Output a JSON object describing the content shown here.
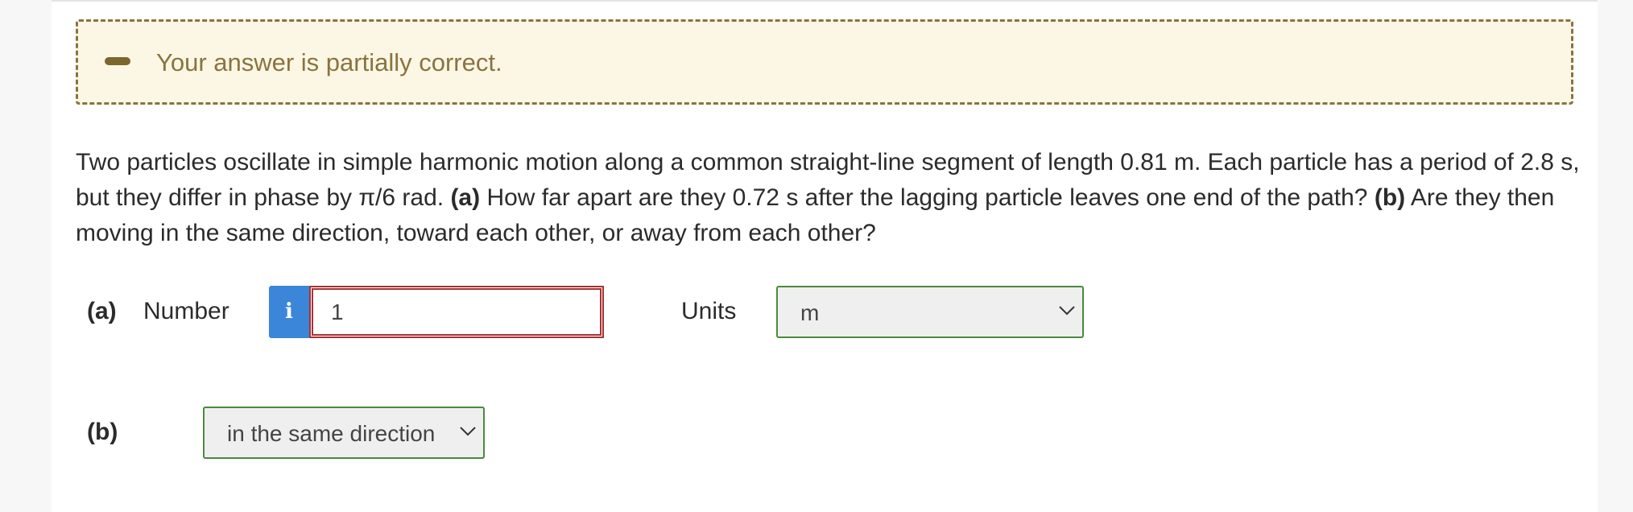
{
  "feedback": {
    "message": "Your answer is partially correct."
  },
  "question": {
    "intro": "Two particles oscillate in simple harmonic motion along a common straight-line segment of length 0.81 m. Each particle has a period of 2.8 s, but they differ in phase by π/6 rad.",
    "part_a_tag": "(a)",
    "part_a_text": "How far apart are they 0.72 s after the lagging particle leaves one end of the path?",
    "part_b_tag": "(b)",
    "part_b_text": "Are they then moving in the same direction, toward each other, or away from each other?"
  },
  "part_a": {
    "label": "(a)",
    "number_label": "Number",
    "info_icon": "i",
    "number_value": "1",
    "units_label": "Units",
    "units_value": "m"
  },
  "part_b": {
    "label": "(b)",
    "direction_value": "in the same direction"
  },
  "icons": {
    "feedback_icon": "minus-icon",
    "info_button": "info-icon",
    "dropdown": "chevron-down-icon"
  },
  "colors": {
    "feedback_bg": "#fbf7e4",
    "feedback_border": "#8a7340",
    "info_button": "#3b86d8",
    "input_error_border": "#a83232",
    "select_border": "#4a8a3a"
  }
}
